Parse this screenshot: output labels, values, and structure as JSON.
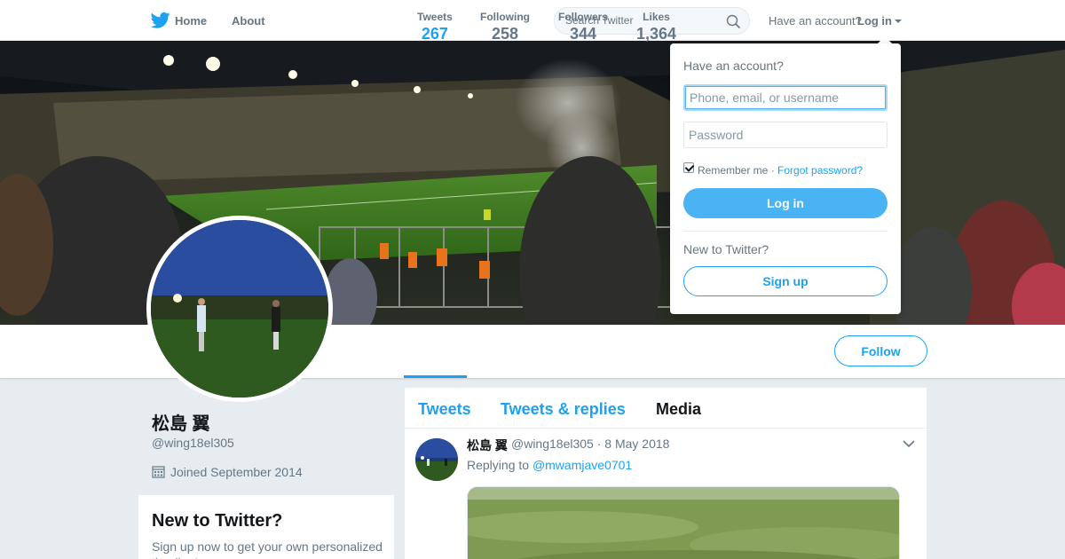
{
  "nav": {
    "home_label": "Home",
    "about_label": "About",
    "search_placeholder": "Search Twitter",
    "have_account": "Have an account?",
    "login_label": "Log in",
    "brand_color": "#1da1f2"
  },
  "profile": {
    "name": "松島 翼",
    "handle": "@wing18el305",
    "joined": "Joined September 2014",
    "stats": [
      {
        "label": "Tweets",
        "value": "267"
      },
      {
        "label": "Following",
        "value": "258"
      },
      {
        "label": "Followers",
        "value": "344"
      },
      {
        "label": "Likes",
        "value": "1,364"
      }
    ],
    "follow_label": "Follow"
  },
  "new_to_twitter": {
    "title": "New to Twitter?",
    "text": "Sign up now to get your own personalized timeline!"
  },
  "timeline": {
    "tabs": [
      "Tweets",
      "Tweets & replies",
      "Media"
    ],
    "tweet": {
      "name": "松島 翼",
      "meta": "@wing18el305 · 8 May 2018",
      "replying_prefix": "Replying to",
      "replying_to": "@mwamjave0701"
    }
  },
  "login_dropdown": {
    "title": "Have an account?",
    "username_placeholder": "Phone, email, or username",
    "password_placeholder": "Password",
    "remember_label": "Remember me ·",
    "forgot_label": "Forgot password?",
    "login_button": "Log in",
    "new_label": "New to Twitter?",
    "signup_button": "Sign up"
  }
}
